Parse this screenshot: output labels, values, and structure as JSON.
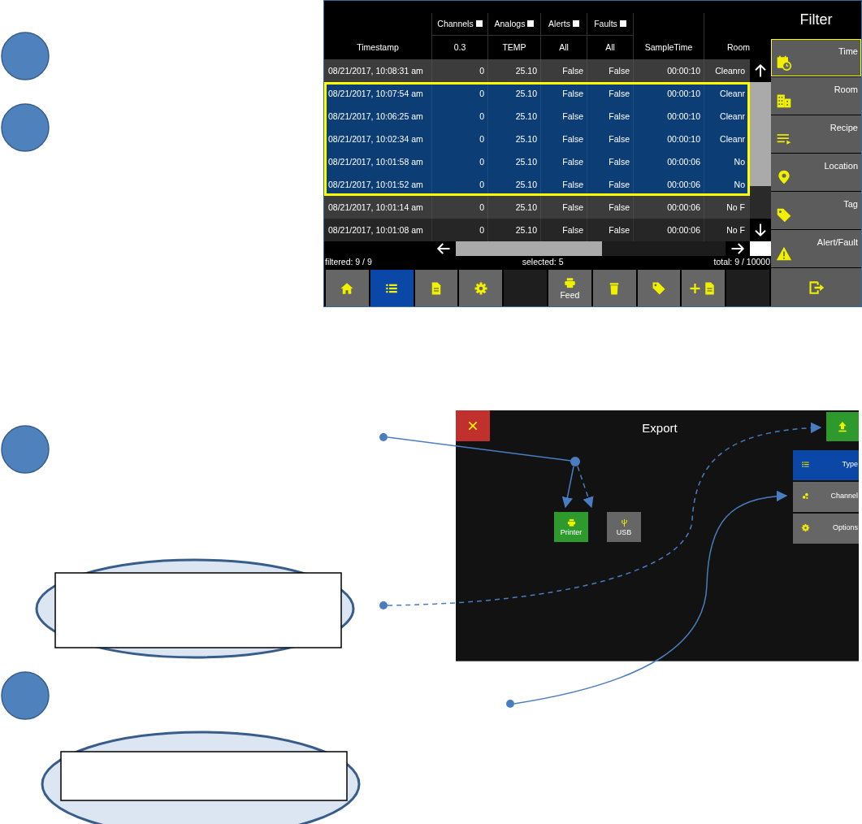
{
  "log_screen": {
    "table": {
      "columns": [
        {
          "label": "Timestamp"
        },
        {
          "group": "Channels",
          "label": "0.3"
        },
        {
          "group": "Analogs",
          "label": "TEMP"
        },
        {
          "group": "Alerts",
          "label": "All"
        },
        {
          "group": "Faults",
          "label": "All"
        },
        {
          "label": "SampleTime"
        },
        {
          "label": "Room"
        }
      ],
      "rows": [
        {
          "selected": false,
          "cells": [
            "08/21/2017, 10:08:31 am",
            "0",
            "25.10",
            "False",
            "False",
            "00:00:10",
            "Cleanro"
          ]
        },
        {
          "selected": true,
          "cells": [
            "08/21/2017, 10:07:54 am",
            "0",
            "25.10",
            "False",
            "False",
            "00:00:10",
            "Cleanr"
          ]
        },
        {
          "selected": true,
          "cells": [
            "08/21/2017, 10:06:25 am",
            "0",
            "25.10",
            "False",
            "False",
            "00:00:10",
            "Cleanr"
          ]
        },
        {
          "selected": true,
          "cells": [
            "08/21/2017, 10:02:34 am",
            "0",
            "25.10",
            "False",
            "False",
            "00:00:10",
            "Cleanr"
          ]
        },
        {
          "selected": true,
          "cells": [
            "08/21/2017, 10:01:58 am",
            "0",
            "25.10",
            "False",
            "False",
            "00:00:06",
            "No"
          ]
        },
        {
          "selected": true,
          "cells": [
            "08/21/2017, 10:01:52 am",
            "0",
            "25.10",
            "False",
            "False",
            "00:00:06",
            "No"
          ]
        },
        {
          "selected": false,
          "cells": [
            "08/21/2017, 10:01:14 am",
            "0",
            "25.10",
            "False",
            "False",
            "00:00:06",
            "No F"
          ]
        },
        {
          "selected": false,
          "cells": [
            "08/21/2017, 10:01:08 am",
            "0",
            "25.10",
            "False",
            "False",
            "00:00:06",
            "No F"
          ]
        }
      ]
    },
    "status_bar": {
      "filtered": "filtered: 9 / 9",
      "selected": "selected: 5",
      "total": "total: 9 / 10000"
    },
    "toolbar": [
      {
        "kind": "home",
        "selected": false
      },
      {
        "kind": "list",
        "selected": true
      },
      {
        "kind": "document",
        "selected": false
      },
      {
        "kind": "settings",
        "selected": false
      },
      {
        "kind": "blank",
        "selected": false
      },
      {
        "kind": "feed",
        "label": "Feed",
        "selected": false
      },
      {
        "kind": "delete",
        "selected": false
      },
      {
        "kind": "tag",
        "selected": false
      },
      {
        "kind": "add-document",
        "selected": false
      },
      {
        "kind": "blank",
        "selected": false
      }
    ],
    "filter": {
      "title": "Filter",
      "items": [
        {
          "kind": "time",
          "label": "Time",
          "selected": true
        },
        {
          "kind": "room",
          "label": "Room",
          "selected": false
        },
        {
          "kind": "recipe",
          "label": "Recipe",
          "selected": false
        },
        {
          "kind": "location",
          "label": "Location",
          "selected": false
        },
        {
          "kind": "tag",
          "label": "Tag",
          "selected": false
        },
        {
          "kind": "alert",
          "label": "Alert/Fault",
          "selected": false
        }
      ]
    }
  },
  "export_screen": {
    "title": "Export",
    "destinations": [
      {
        "kind": "printer",
        "label": "Printer",
        "selected": true
      },
      {
        "kind": "usb",
        "label": "USB",
        "selected": false
      }
    ],
    "tabs": [
      {
        "kind": "type",
        "label": "Type",
        "selected": true
      },
      {
        "kind": "channel",
        "label": "Channel",
        "selected": false
      },
      {
        "kind": "options",
        "label": "Options",
        "selected": false
      }
    ]
  }
}
